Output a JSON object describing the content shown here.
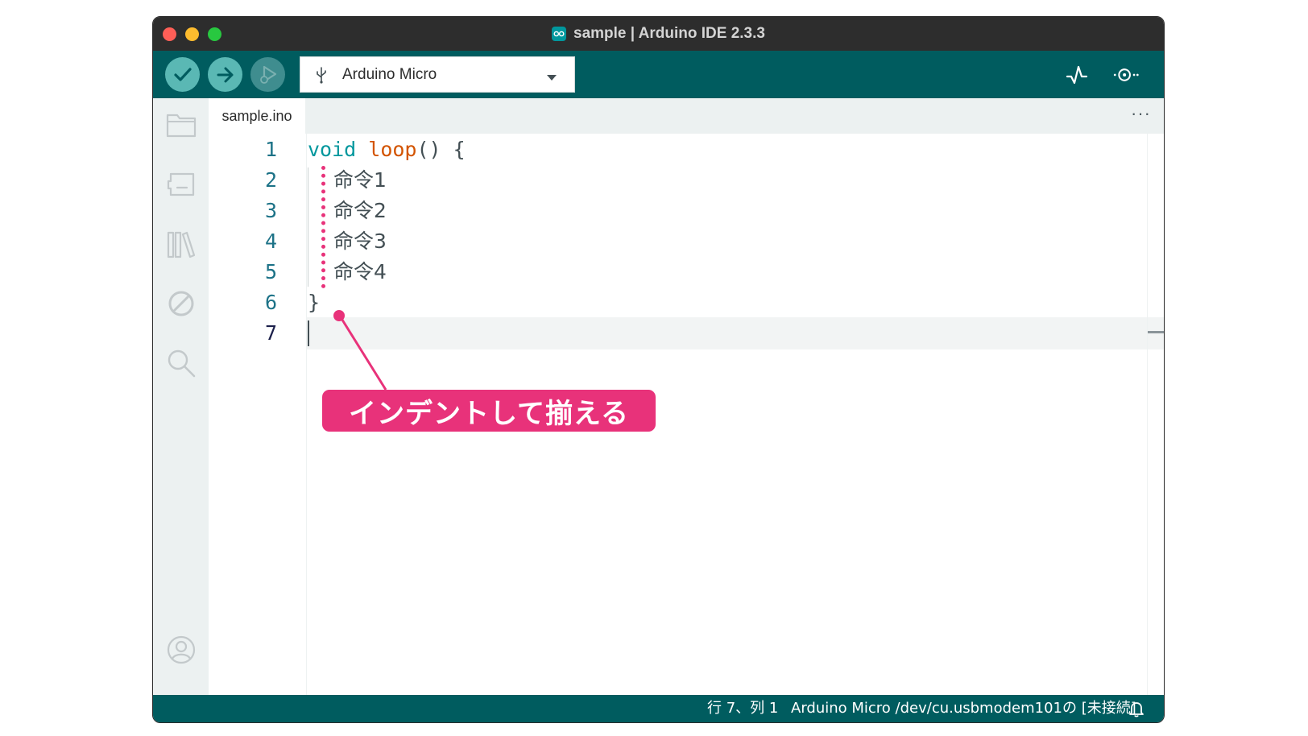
{
  "window": {
    "title": "sample | Arduino IDE 2.3.3"
  },
  "toolbar": {
    "verify_icon": "check-icon",
    "upload_icon": "arrow-right-icon",
    "debug_icon": "debug-icon",
    "board_icon": "usb-icon",
    "board_name": "Arduino Micro",
    "plotter_icon": "serial-plotter-icon",
    "monitor_icon": "serial-monitor-icon"
  },
  "sidebar": {
    "items": [
      {
        "name": "sketchbook",
        "icon": "folder-icon"
      },
      {
        "name": "boards-manager",
        "icon": "board-icon"
      },
      {
        "name": "library-manager",
        "icon": "library-icon"
      },
      {
        "name": "debug",
        "icon": "no-debug-icon"
      },
      {
        "name": "search",
        "icon": "search-icon"
      },
      {
        "name": "profile",
        "icon": "user-icon"
      }
    ]
  },
  "tabs": [
    {
      "label": "sample.ino",
      "active": true
    }
  ],
  "tab_more": "···",
  "editor": {
    "line_numbers": [
      "1",
      "2",
      "3",
      "4",
      "5",
      "6",
      "7"
    ],
    "current_line": 7,
    "code": {
      "line1_keyword": "void",
      "line1_space": " ",
      "line1_function": "loop",
      "line1_rest": "() {",
      "line2": "命令1",
      "line3": "命令2",
      "line4": "命令3",
      "line5": "命令4",
      "line6": "}",
      "line7": ""
    }
  },
  "annotation": {
    "text": "インデントして揃える",
    "color": "#e8327a"
  },
  "status_bar": {
    "position": "行 7、列 1",
    "board": "Arduino Micro /dev/cu.usbmodem101の [未接続]",
    "bell_icon": "bell-icon"
  },
  "colors": {
    "teal_dark": "#005c5f",
    "teal_button": "#5ab8b4",
    "keyword": "#00979d",
    "function": "#d35400",
    "line_number": "#1c7287"
  }
}
